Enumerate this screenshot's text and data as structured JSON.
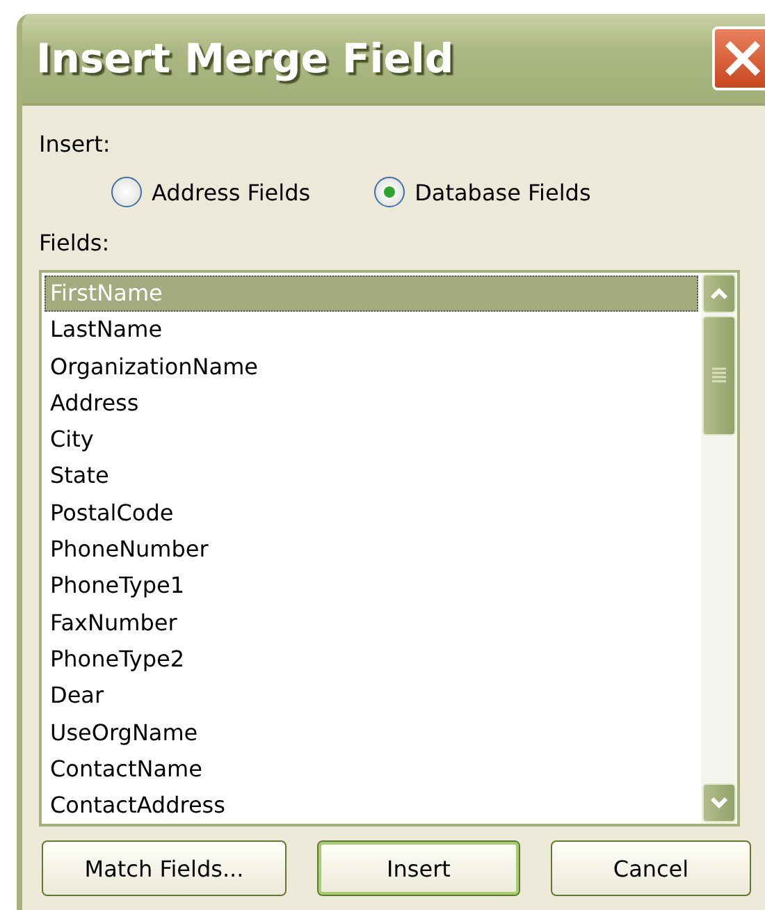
{
  "window": {
    "title": "Insert Merge Field"
  },
  "insert": {
    "label": "Insert:",
    "options": [
      {
        "label": "Address Fields",
        "selected": false
      },
      {
        "label": "Database Fields",
        "selected": true
      }
    ]
  },
  "fields": {
    "label": "Fields:",
    "items": [
      {
        "label": "FirstName",
        "selected": true
      },
      {
        "label": "LastName",
        "selected": false
      },
      {
        "label": "OrganizationName",
        "selected": false
      },
      {
        "label": "Address",
        "selected": false
      },
      {
        "label": "City",
        "selected": false
      },
      {
        "label": "State",
        "selected": false
      },
      {
        "label": "PostalCode",
        "selected": false
      },
      {
        "label": "PhoneNumber",
        "selected": false
      },
      {
        "label": "PhoneType1",
        "selected": false
      },
      {
        "label": "FaxNumber",
        "selected": false
      },
      {
        "label": "PhoneType2",
        "selected": false
      },
      {
        "label": "Dear",
        "selected": false
      },
      {
        "label": "UseOrgName",
        "selected": false
      },
      {
        "label": "ContactName",
        "selected": false
      },
      {
        "label": "ContactAddress",
        "selected": false
      }
    ]
  },
  "buttons": [
    {
      "label": "Match Fields...",
      "default": false
    },
    {
      "label": "Insert",
      "default": true
    },
    {
      "label": "Cancel",
      "default": false
    }
  ]
}
